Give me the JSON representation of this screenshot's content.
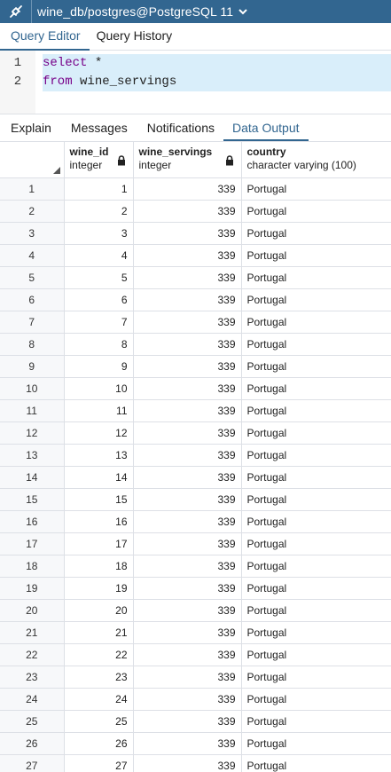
{
  "title_bar": {
    "connection": "wine_db/postgres@PostgreSQL 11"
  },
  "query_tabs": [
    {
      "label": "Query Editor",
      "active": true
    },
    {
      "label": "Query History",
      "active": false
    }
  ],
  "editor": {
    "lines": [
      {
        "number": "1",
        "keyword": "select",
        "rest": " *"
      },
      {
        "number": "2",
        "keyword": "from",
        "rest": " wine_servings"
      }
    ]
  },
  "output_tabs": [
    {
      "label": "Explain",
      "active": false
    },
    {
      "label": "Messages",
      "active": false
    },
    {
      "label": "Notifications",
      "active": false
    },
    {
      "label": "Data Output",
      "active": true
    }
  ],
  "grid": {
    "columns": [
      {
        "name": "wine_id",
        "type": "integer"
      },
      {
        "name": "wine_servings",
        "type": "integer"
      },
      {
        "name": "country",
        "type": "character varying (100)"
      }
    ],
    "rows": [
      [
        "1",
        "1",
        "339",
        "Portugal"
      ],
      [
        "2",
        "2",
        "339",
        "Portugal"
      ],
      [
        "3",
        "3",
        "339",
        "Portugal"
      ],
      [
        "4",
        "4",
        "339",
        "Portugal"
      ],
      [
        "5",
        "5",
        "339",
        "Portugal"
      ],
      [
        "6",
        "6",
        "339",
        "Portugal"
      ],
      [
        "7",
        "7",
        "339",
        "Portugal"
      ],
      [
        "8",
        "8",
        "339",
        "Portugal"
      ],
      [
        "9",
        "9",
        "339",
        "Portugal"
      ],
      [
        "10",
        "10",
        "339",
        "Portugal"
      ],
      [
        "11",
        "11",
        "339",
        "Portugal"
      ],
      [
        "12",
        "12",
        "339",
        "Portugal"
      ],
      [
        "13",
        "13",
        "339",
        "Portugal"
      ],
      [
        "14",
        "14",
        "339",
        "Portugal"
      ],
      [
        "15",
        "15",
        "339",
        "Portugal"
      ],
      [
        "16",
        "16",
        "339",
        "Portugal"
      ],
      [
        "17",
        "17",
        "339",
        "Portugal"
      ],
      [
        "18",
        "18",
        "339",
        "Portugal"
      ],
      [
        "19",
        "19",
        "339",
        "Portugal"
      ],
      [
        "20",
        "20",
        "339",
        "Portugal"
      ],
      [
        "21",
        "21",
        "339",
        "Portugal"
      ],
      [
        "22",
        "22",
        "339",
        "Portugal"
      ],
      [
        "23",
        "23",
        "339",
        "Portugal"
      ],
      [
        "24",
        "24",
        "339",
        "Portugal"
      ],
      [
        "25",
        "25",
        "339",
        "Portugal"
      ],
      [
        "26",
        "26",
        "339",
        "Portugal"
      ],
      [
        "27",
        "27",
        "339",
        "Portugal"
      ]
    ]
  },
  "colors": {
    "title_bar_bg": "#326690",
    "accent": "#326690",
    "keyword": "#770088",
    "editor_highlight": "#d9eefa"
  },
  "icons": {
    "connection": "plug-link-icon",
    "dropdown": "chevron-down-icon",
    "locked_column": "lock-icon",
    "sort_corner": "triangle-corner-icon"
  }
}
